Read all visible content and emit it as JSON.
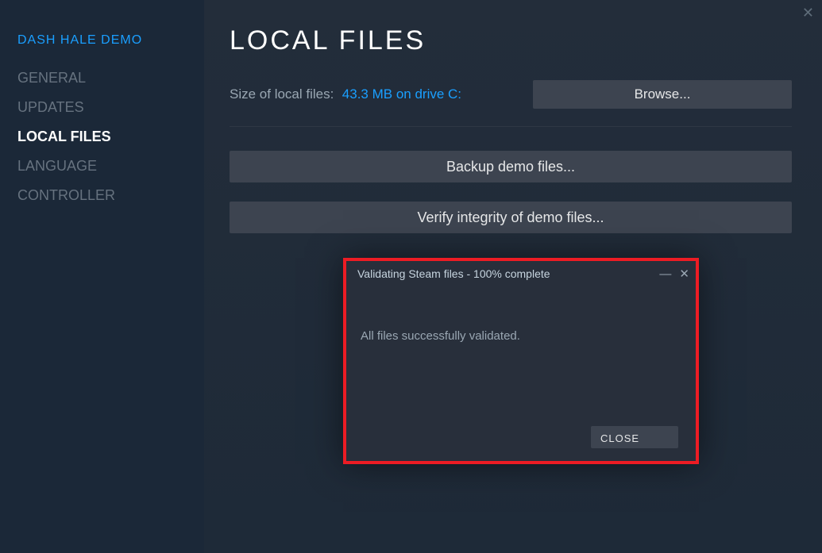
{
  "sidebar": {
    "title": "DASH HALE DEMO",
    "items": [
      {
        "label": "GENERAL",
        "active": false
      },
      {
        "label": "UPDATES",
        "active": false
      },
      {
        "label": "LOCAL FILES",
        "active": true
      },
      {
        "label": "LANGUAGE",
        "active": false
      },
      {
        "label": "CONTROLLER",
        "active": false
      }
    ]
  },
  "main": {
    "close_glyph": "✕",
    "title": "LOCAL FILES",
    "size_label": "Size of local files:",
    "size_value": "43.3 MB on drive C:",
    "browse_label": "Browse...",
    "backup_label": "Backup demo files...",
    "verify_label": "Verify integrity of demo files..."
  },
  "modal": {
    "title": "Validating Steam files - 100% complete",
    "minimize_glyph": "—",
    "close_glyph": "✕",
    "message": "All files successfully validated.",
    "close_button": "CLOSE"
  }
}
